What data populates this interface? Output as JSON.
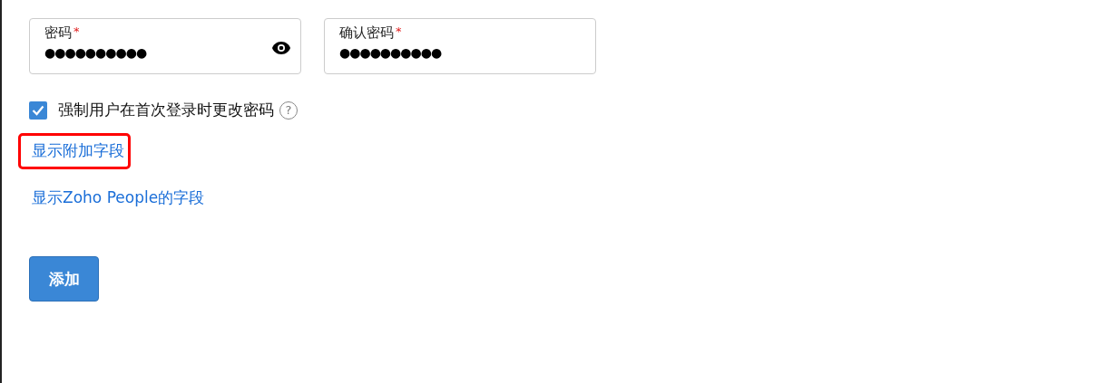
{
  "fields": [
    {
      "label": "密码",
      "required_mark": "*",
      "value": "●●●●●●●●●●",
      "reveal_toggle": true
    },
    {
      "label": "确认密码",
      "required_mark": "*",
      "value": "●●●●●●●●●●",
      "reveal_toggle": false
    }
  ],
  "force_change": {
    "label": "强制用户在首次登录时更改密码",
    "checked": true,
    "help": "?"
  },
  "links": [
    {
      "label": "显示附加字段",
      "highlighted": true
    },
    {
      "label": "显示Zoho People的字段",
      "highlighted": false
    }
  ],
  "submit_button": "添加"
}
